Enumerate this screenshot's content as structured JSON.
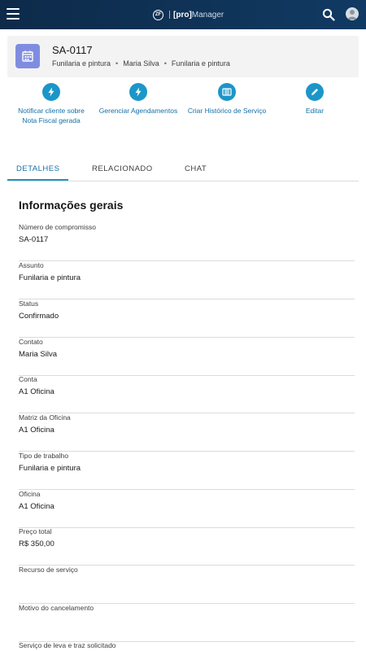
{
  "topbar": {
    "brand_logo": "ZF",
    "brand_pro": "[pro]",
    "brand_manager": "Manager"
  },
  "record": {
    "title": "SA-0117",
    "subtitle": [
      "Funilaria e pintura",
      "Maria Silva",
      "Funilaria e pintura"
    ]
  },
  "actions": [
    {
      "label": "Notificar cliente sobre Nota Fiscal gerada",
      "icon": "lightning-icon"
    },
    {
      "label": "Gerenciar Agendamentos",
      "icon": "lightning-icon"
    },
    {
      "label": "Criar Histórico de Serviço",
      "icon": "book-icon"
    },
    {
      "label": "Editar",
      "icon": "pencil-icon"
    }
  ],
  "tabs": [
    "DETALHES",
    "RELACIONADO",
    "CHAT"
  ],
  "active_tab": "DETALHES",
  "details": {
    "section_title": "Informações gerais",
    "fields": [
      {
        "label": "Número de compromisso",
        "value": "SA-0117"
      },
      {
        "label": "Assunto",
        "value": "Funilaria e pintura"
      },
      {
        "label": "Status",
        "value": "Confirmado"
      },
      {
        "label": "Contato",
        "value": "Maria Silva"
      },
      {
        "label": "Conta",
        "value": "A1 Oficina"
      },
      {
        "label": "Matriz da Oficina",
        "value": "A1 Oficina"
      },
      {
        "label": "Tipo de trabalho",
        "value": "Funilaria e pintura"
      },
      {
        "label": "Oficina",
        "value": "A1 Oficina"
      },
      {
        "label": "Preço total",
        "value": "R$ 350,00"
      },
      {
        "label": "Recurso de serviço",
        "value": ""
      },
      {
        "label": "Motivo do cancelamento",
        "value": ""
      },
      {
        "label": "Serviço de leva e traz solicitado",
        "value": ""
      }
    ]
  },
  "colors": {
    "topbar": "#0f3357",
    "accent": "#1b96c9",
    "link": "#1370a8",
    "record_icon": "#7f8de1"
  }
}
